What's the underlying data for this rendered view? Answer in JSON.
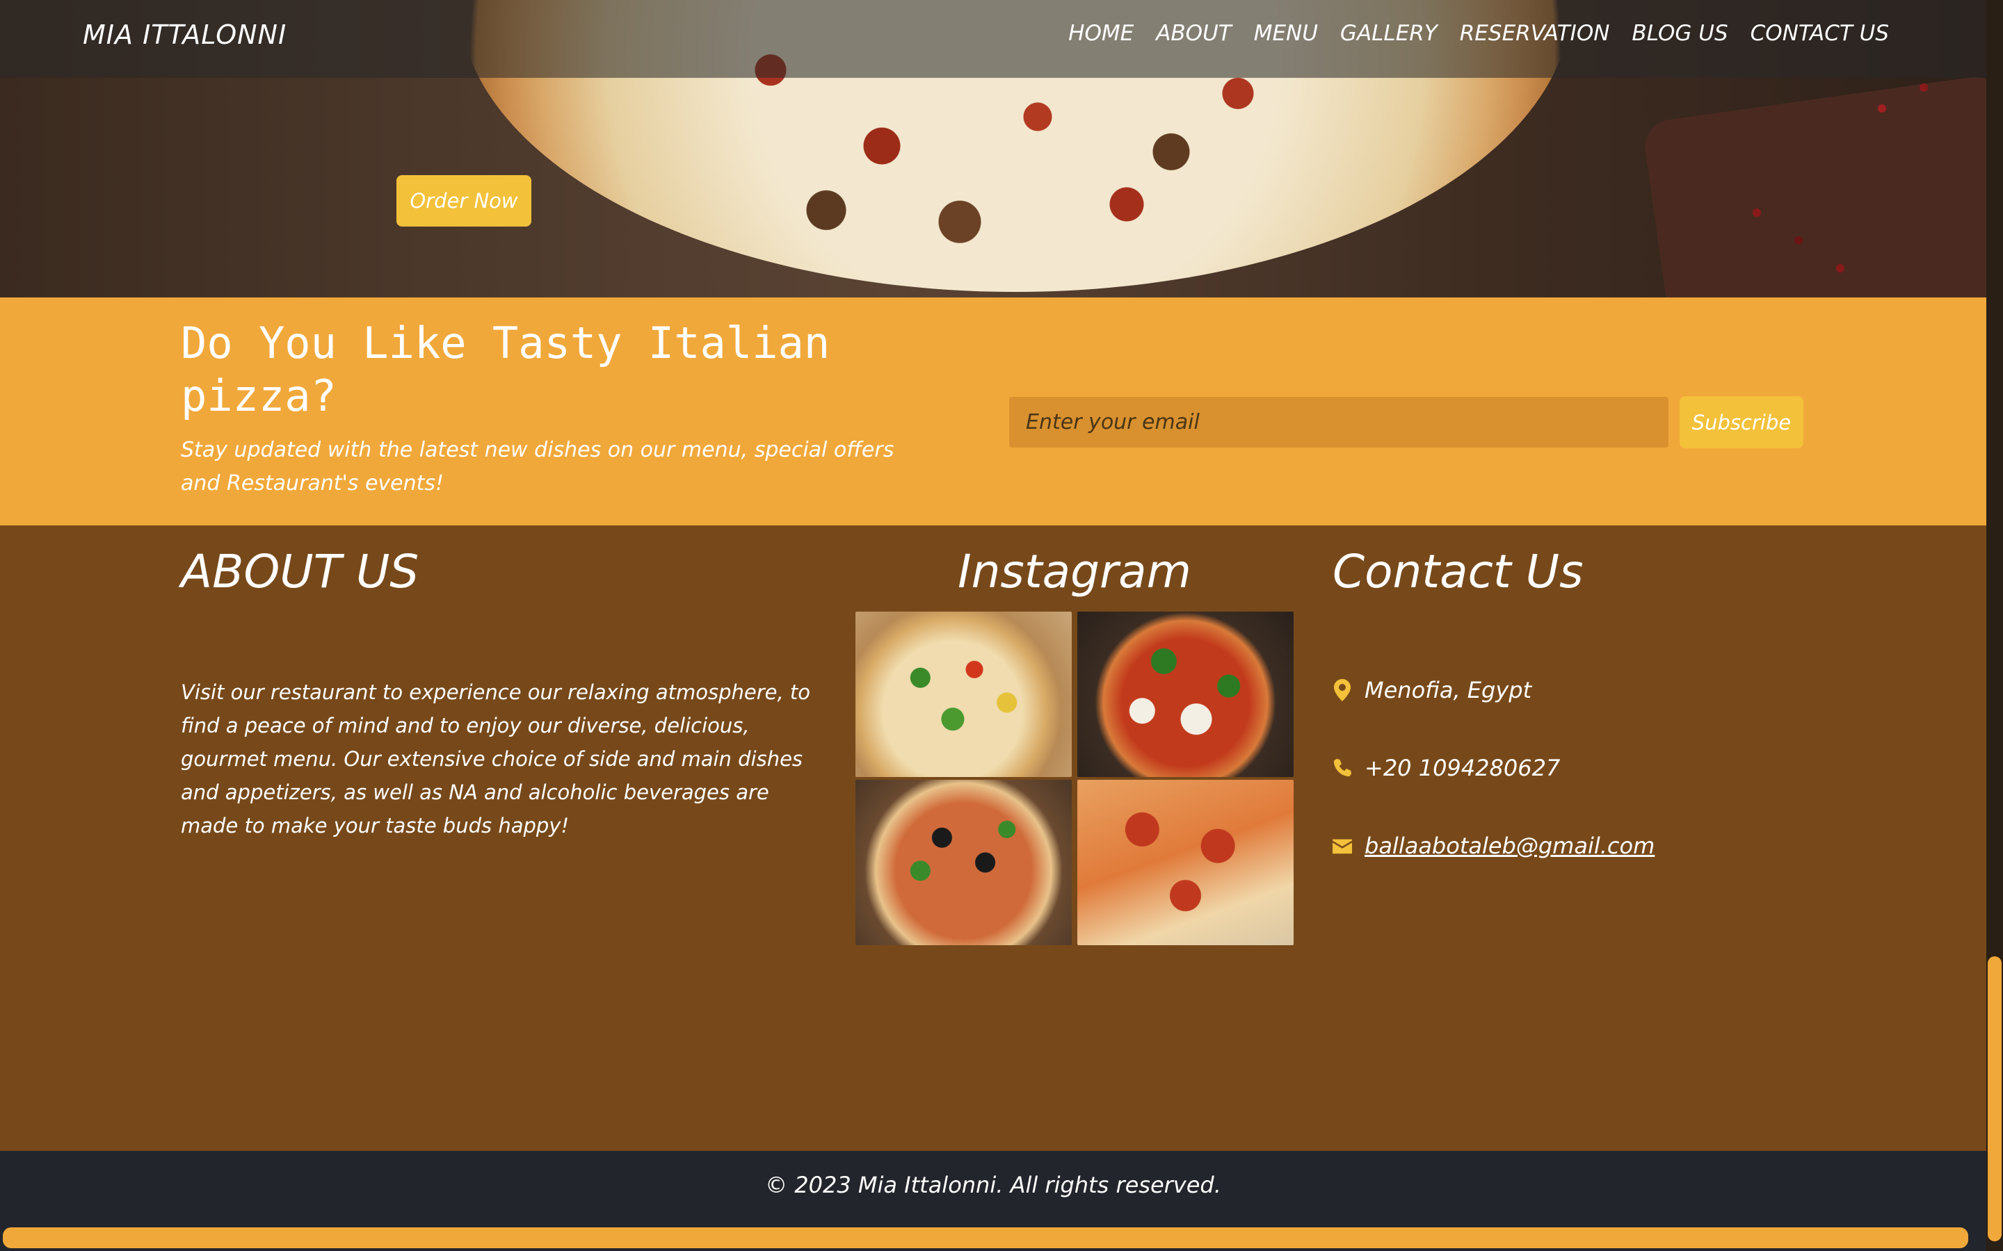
{
  "navbar": {
    "brand": "MIA ITTALONNI",
    "links": [
      "HOME",
      "ABOUT",
      "MENU",
      "GALLERY",
      "RESERVATION",
      "BLOG US",
      "CONTACT US"
    ]
  },
  "hero": {
    "order_button": "Order Now"
  },
  "newsletter": {
    "title": "Do You Like Tasty Italian pizza?",
    "subtitle": "Stay updated with the latest new dishes on our menu, special offers and Restaurant's events!",
    "email_placeholder": "Enter your email",
    "subscribe_label": "Subscribe"
  },
  "about": {
    "title": "ABOUT US",
    "text": "Visit our restaurant to experience our relaxing atmosphere, to find a peace of mind and to enjoy our diverse, delicious, gourmet menu. Our extensive choice of side and main dishes and appetizers, as well as NA and alcoholic beverages are made to make your taste buds happy!"
  },
  "instagram": {
    "title": "Instagram"
  },
  "contact": {
    "title": "Contact Us",
    "location": "Menofia, Egypt",
    "phone": "+20 1094280627",
    "email": "ballaabotaleb@gmail.com",
    "icons": [
      "map-marker-icon",
      "phone-icon",
      "envelope-icon"
    ]
  },
  "footer": {
    "copyright": "© 2023 Mia Ittalonni. All rights reserved."
  },
  "colors": {
    "accent": "#f1a83a",
    "button": "#f3c13a",
    "info_bg": "#77491a",
    "footer_bg": "#22252b"
  }
}
